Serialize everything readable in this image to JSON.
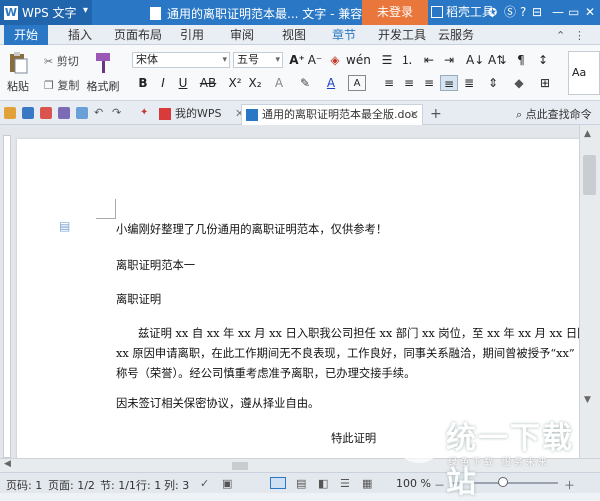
{
  "app": {
    "logo_text": "WPS 文字",
    "title": "通用的离职证明范本最... 文字 - 兼容模式",
    "login_label": "未登录",
    "tools_label": "稻壳工具",
    "help_label": "?"
  },
  "tabs": [
    {
      "label": "开始"
    },
    {
      "label": "插入"
    },
    {
      "label": "页面布局"
    },
    {
      "label": "引用"
    },
    {
      "label": "审阅"
    },
    {
      "label": "视图"
    },
    {
      "label": "章节"
    },
    {
      "label": "开发工具"
    },
    {
      "label": "云服务"
    }
  ],
  "ribbon": {
    "paste_label": "粘贴",
    "cut_label": "剪切",
    "copy_label": "复制",
    "format_painter_label": "格式刷",
    "font_name": "宋体",
    "font_size": "五号",
    "styles_preview": "Aa"
  },
  "doc_tabs": {
    "mywps_label": "我的WPS",
    "doc_label": "通用的离职证明范本最全版.doc",
    "search_label": "点此查找命令"
  },
  "document": {
    "lines": [
      "小编刚好整理了几份通用的离职证明范本，仅供参考！",
      "离职证明范本一",
      "离职证明",
      "兹证明 xx 自 xx 年 xx 月 xx 日入职我公司担任 xx 部门 xx 岗位，至 xx 年 xx 月 xx 日因",
      "xx 原因申请离职，在此工作期间无不良表现，工作良好，同事关系融洽，期间曾被授予“xx”",
      "称号（荣誉）。经公司慎重考虑准予离职，已办理交接手续。",
      "因未签订相关保密协议，遵从择业自由。",
      "特此证明"
    ]
  },
  "status": {
    "page_code": "页码: 1",
    "pages": "页面: 1/2",
    "section": "节: 1/1",
    "row": "行: 1",
    "col": "列: 3",
    "zoom": "100 %"
  },
  "watermark": {
    "text": "统一下载站",
    "subtext": "绿色下载 服务未来"
  },
  "colors": {
    "accent": "#2a78c5",
    "login_bg": "#e9763b"
  }
}
